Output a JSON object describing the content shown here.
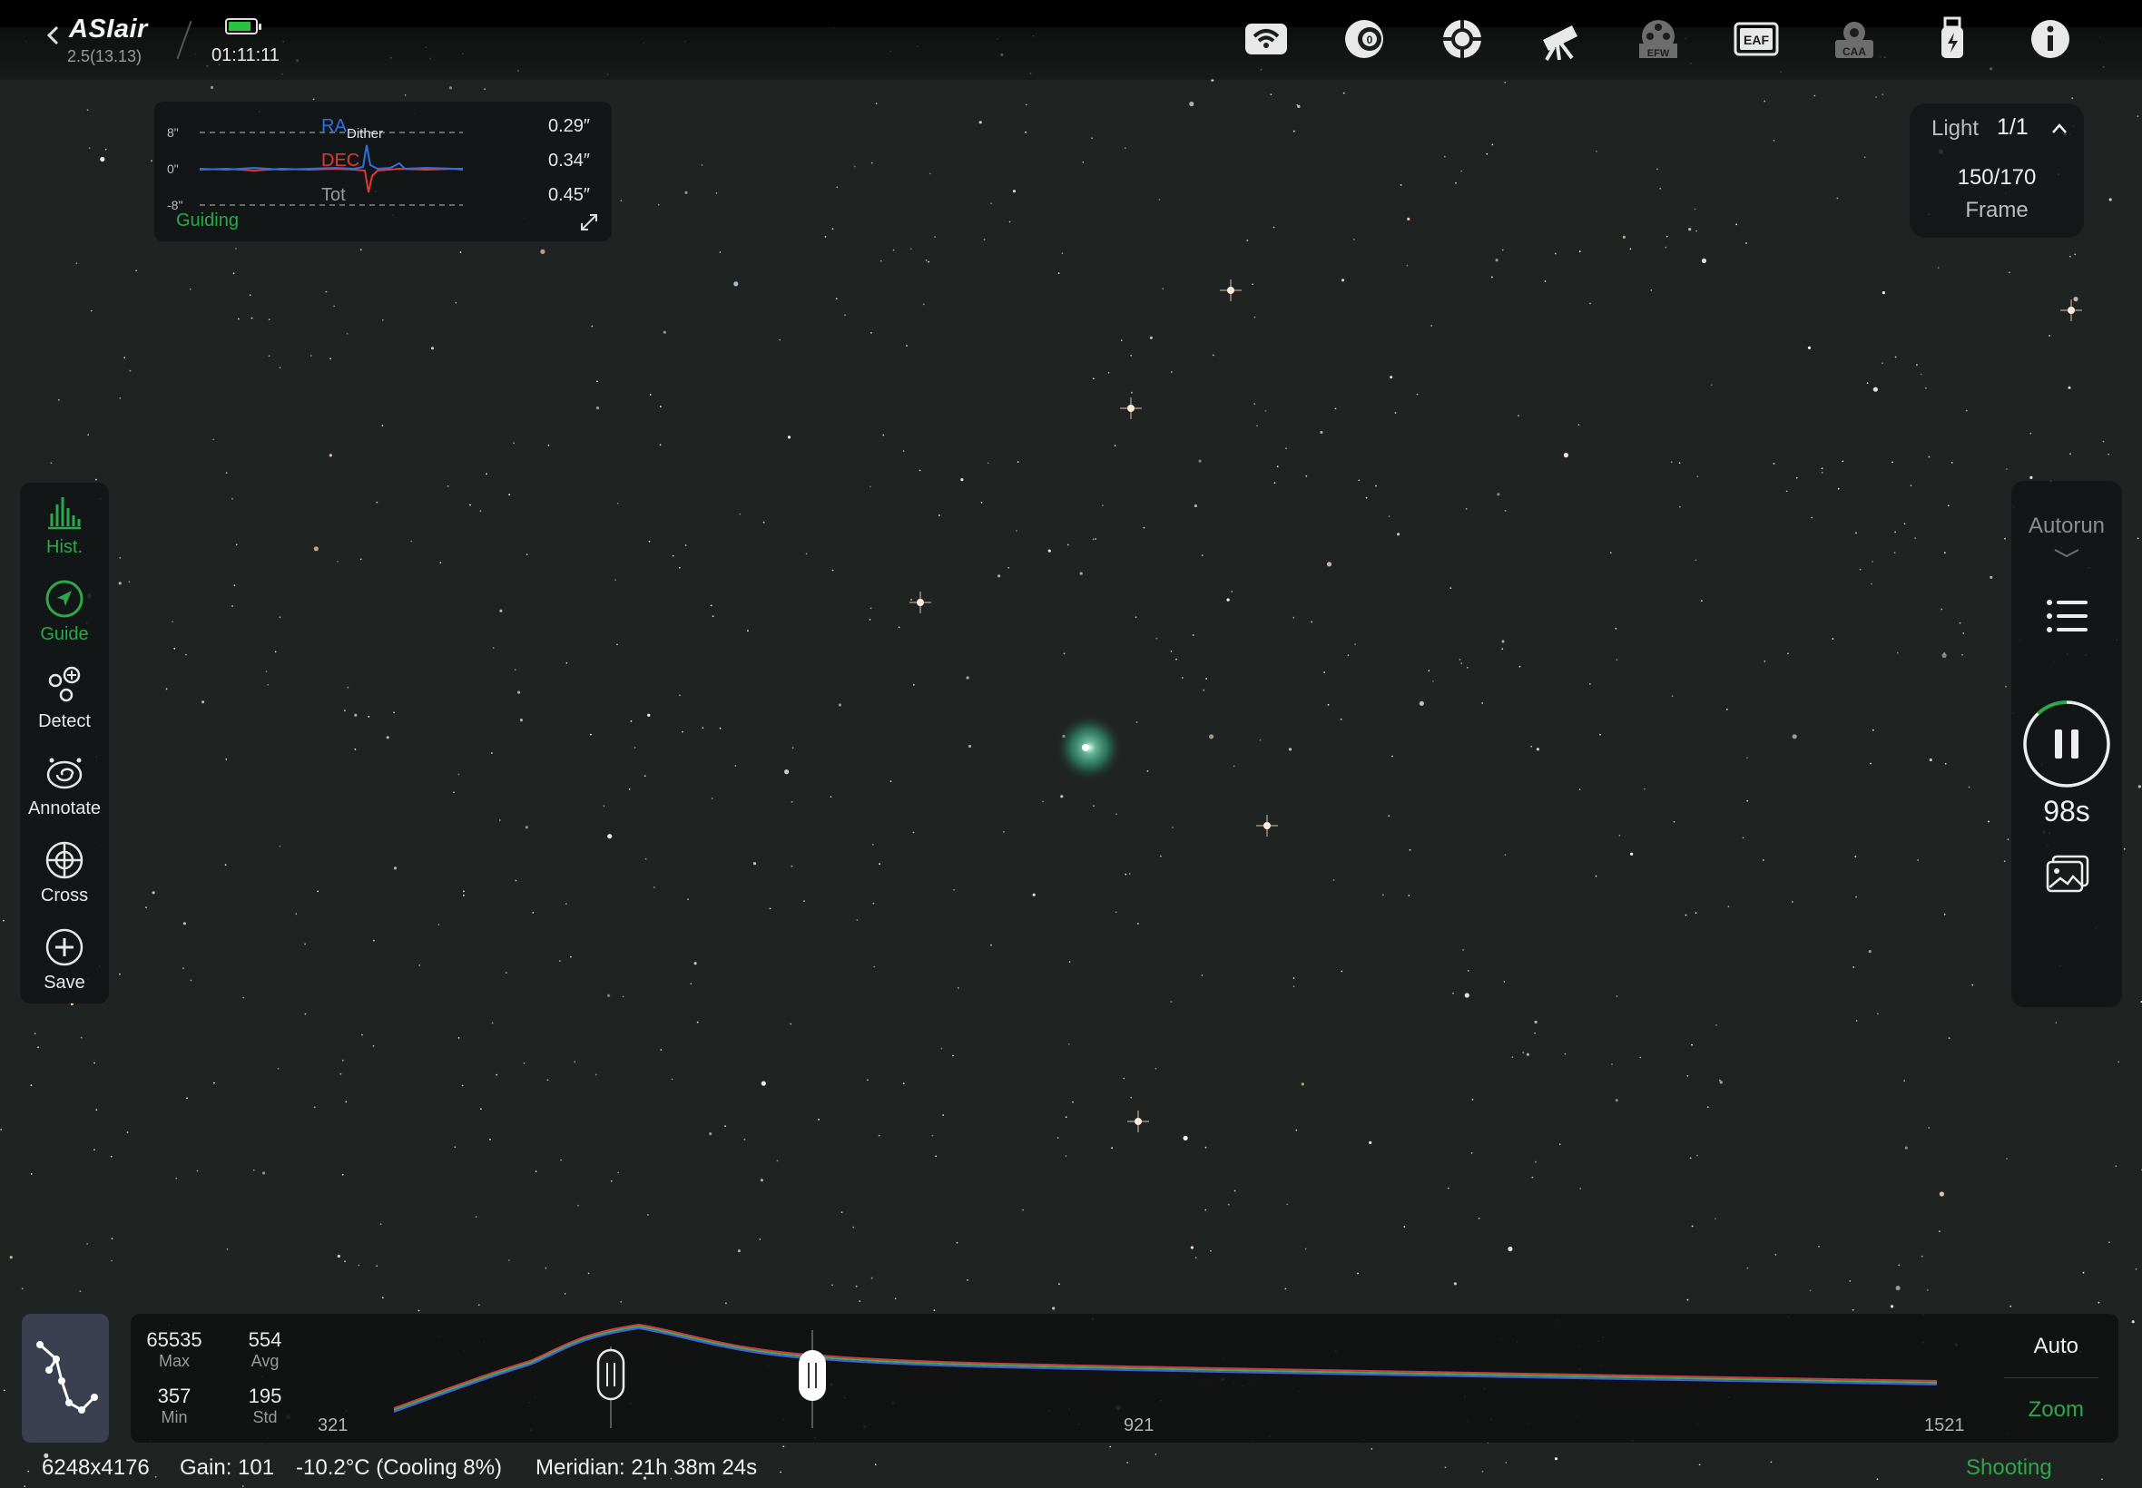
{
  "app": {
    "name": "ASIair",
    "version": "2.5(13.13)",
    "clock": "01:11:11",
    "battery_level_percent": 85
  },
  "topbar_icons": [
    "wifi-icon",
    "camera-icon",
    "guide-scope-icon",
    "telescope-icon",
    "efw-icon",
    "eaf-icon",
    "caa-icon",
    "usb-icon",
    "info-icon"
  ],
  "topbar_labels": {
    "efw": "EFW",
    "eaf": "EAF",
    "caa": "CAA"
  },
  "guiding": {
    "axis_top": "8\"",
    "axis_mid": "0\"",
    "axis_bot": "-8\"",
    "annotation": "Dither",
    "ra_label": "RA",
    "ra_value": "0.29″",
    "dec_label": "DEC",
    "dec_value": "0.34″",
    "tot_label": "Tot",
    "tot_value": "0.45″",
    "status": "Guiding",
    "colors": {
      "ra": "#2f6fe0",
      "dec": "#e03a2f",
      "status": "#2ca84a"
    }
  },
  "frame": {
    "type": "Light",
    "index": "1/1",
    "count": "150/170",
    "label": "Frame"
  },
  "tools": [
    {
      "label": "Hist.",
      "icon": "histogram-icon",
      "active": true
    },
    {
      "label": "Guide",
      "icon": "guide-icon",
      "active": true
    },
    {
      "label": "Detect",
      "icon": "detect-icon",
      "active": false
    },
    {
      "label": "Annotate",
      "icon": "annotate-icon",
      "active": false
    },
    {
      "label": "Cross",
      "icon": "crosshair-icon",
      "active": false
    },
    {
      "label": "Save",
      "icon": "save-icon",
      "active": false
    }
  ],
  "right_panel": {
    "autorun": "Autorun",
    "countdown": "98s",
    "exposure_progress": 0.12
  },
  "histogram": {
    "max_value": "65535",
    "max_label": "Max",
    "avg_value": "554",
    "avg_label": "Avg",
    "min_value": "357",
    "min_label": "Min",
    "std_value": "195",
    "std_label": "Std",
    "tick_left": "321",
    "tick_mid": "921",
    "tick_right": "1521",
    "auto": "Auto",
    "zoom": "Zoom"
  },
  "status_bar": {
    "resolution": "6248x4176",
    "gain": "Gain: 101",
    "temperature": "-10.2°C (Cooling 8%)",
    "meridian": "Meridian: 21h 38m 24s",
    "state": "Shooting"
  },
  "accent_color": "#2ca84a"
}
